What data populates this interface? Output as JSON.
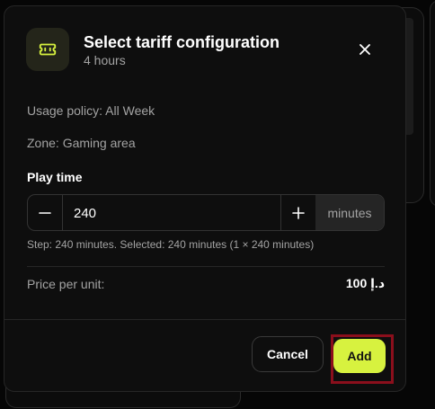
{
  "dialog": {
    "title": "Select tariff configuration",
    "subtitle": "4 hours",
    "icon": "ticket-icon",
    "close_icon": "close-icon"
  },
  "details": {
    "usage_policy": "Usage policy: All Week",
    "zone": "Zone: Gaming area"
  },
  "play_time": {
    "label": "Play time",
    "value": "240",
    "unit": "minutes",
    "hint": "Step: 240 minutes. Selected: 240 minutes (1 × 240 minutes)"
  },
  "price": {
    "label": "Price per unit:",
    "value": "100 د.إ"
  },
  "actions": {
    "cancel_label": "Cancel",
    "add_label": "Add"
  },
  "colors": {
    "accent": "#d7f23f",
    "highlight": "#8b0f1c",
    "background": "#0e0e0e"
  }
}
